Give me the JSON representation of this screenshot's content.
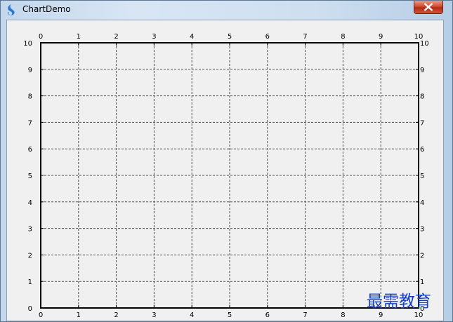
{
  "window": {
    "title": "ChartDemo"
  },
  "icons": {
    "app": "app-icon",
    "close": "close-icon"
  },
  "colors": {
    "plot_background": "#f0f0f0",
    "grid": "#505050",
    "axis": "#000000",
    "watermark": "#1a3fbe"
  },
  "chart_data": {
    "type": "line",
    "x": [],
    "series": [],
    "title": "",
    "xlabel": "",
    "ylabel": "",
    "xlim": [
      0,
      10
    ],
    "ylim": [
      0,
      10
    ],
    "xticks": [
      0,
      1,
      2,
      3,
      4,
      5,
      6,
      7,
      8,
      9,
      10
    ],
    "yticks": [
      0,
      1,
      2,
      3,
      4,
      5,
      6,
      7,
      8,
      9,
      10
    ],
    "tick_labels_on": [
      "left",
      "right",
      "top",
      "bottom"
    ],
    "grid": true,
    "grid_style": "dashed"
  },
  "watermark": {
    "text": "最需教育"
  }
}
